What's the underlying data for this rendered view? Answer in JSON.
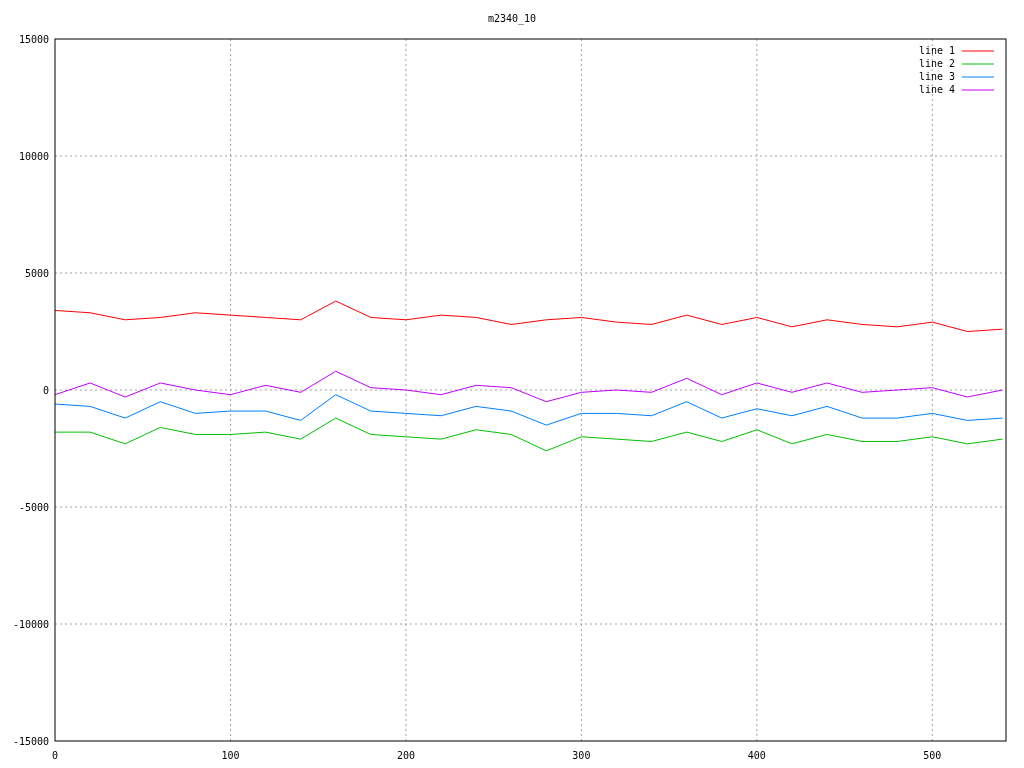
{
  "chart_data": {
    "type": "line",
    "title": "m2340_10",
    "x": [
      0,
      20,
      40,
      60,
      80,
      100,
      120,
      140,
      160,
      180,
      200,
      220,
      240,
      260,
      280,
      300,
      320,
      340,
      360,
      380,
      400,
      420,
      440,
      460,
      480,
      500,
      520,
      540
    ],
    "series": [
      {
        "name": "line 1",
        "color": "#ff0000",
        "values": [
          3400,
          3300,
          3000,
          3100,
          3300,
          3200,
          3100,
          3000,
          3800,
          3100,
          3000,
          3200,
          3100,
          2800,
          3000,
          3100,
          2900,
          2800,
          3200,
          2800,
          3100,
          2700,
          3000,
          2800,
          2700,
          2900,
          2500,
          2600
        ]
      },
      {
        "name": "line 2",
        "color": "#00c000",
        "values": [
          -1800,
          -1800,
          -2300,
          -1600,
          -1900,
          -1900,
          -1800,
          -2100,
          -1200,
          -1900,
          -2000,
          -2100,
          -1700,
          -1900,
          -2600,
          -2000,
          -2100,
          -2200,
          -1800,
          -2200,
          -1700,
          -2300,
          -1900,
          -2200,
          -2200,
          -2000,
          -2300,
          -2100
        ]
      },
      {
        "name": "line 3",
        "color": "#0080ff",
        "values": [
          -600,
          -700,
          -1200,
          -500,
          -1000,
          -900,
          -900,
          -1300,
          -200,
          -900,
          -1000,
          -1100,
          -700,
          -900,
          -1500,
          -1000,
          -1000,
          -1100,
          -500,
          -1200,
          -800,
          -1100,
          -700,
          -1200,
          -1200,
          -1000,
          -1300,
          -1200
        ]
      },
      {
        "name": "line 4",
        "color": "#c000ff",
        "values": [
          -200,
          300,
          -300,
          300,
          0,
          -200,
          200,
          -100,
          800,
          100,
          0,
          -200,
          200,
          100,
          -500,
          -100,
          0,
          -100,
          500,
          -200,
          300,
          -100,
          300,
          -100,
          0,
          100,
          -300,
          0
        ]
      }
    ],
    "xlim": [
      0,
      542
    ],
    "ylim": [
      -15000,
      15000
    ],
    "xticks": [
      0,
      100,
      200,
      300,
      400,
      500
    ],
    "yticks": [
      -15000,
      -10000,
      -5000,
      0,
      5000,
      10000,
      15000
    ],
    "grid": true,
    "legend": true
  }
}
